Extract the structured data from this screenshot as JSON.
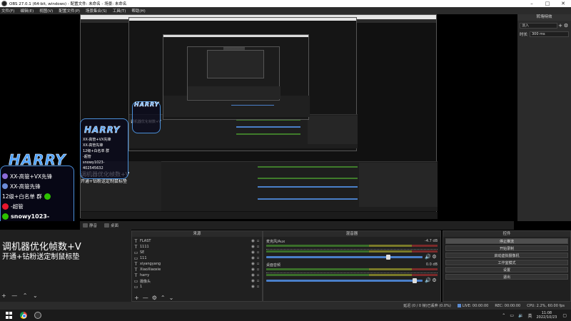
{
  "window": {
    "title": "OBS 27.0.1 (64-bit, windows) - 配置文件: 未命名 - 场景: 未命名",
    "controls": [
      "–",
      "□",
      "✕"
    ]
  },
  "menu": [
    "文件(F)",
    "编辑(E)",
    "视图(V)",
    "配置文件(P)",
    "场景集合(S)",
    "工具(T)",
    "帮助(H)"
  ],
  "right_panel": {
    "title": "转场特效",
    "transition": "淡入",
    "duration_label": "时长",
    "duration_value": "300 ms"
  },
  "preview_overlay": {
    "logo": "HARRY",
    "lines": [
      "XX-高管+VX先锋",
      "XX-高管先锋",
      "12级+白名单 群",
      "-超管",
      "snowy1023-",
      "402545632"
    ],
    "brand": "骑眉"
  },
  "sub_bar": {
    "mic": "静音",
    "desktop": "桌面"
  },
  "left_bottom": {
    "big_text": "调机器优化帧数+V",
    "small_text": "开通+钻粉送定制鼠标垫",
    "footer": [
      "+",
      "—",
      "⌃",
      "⌄"
    ]
  },
  "sources": {
    "title": "来源",
    "items": [
      {
        "icon": "T",
        "name": "FLAST"
      },
      {
        "icon": "T",
        "name": "1111"
      },
      {
        "icon": "▭",
        "name": "SE"
      },
      {
        "icon": "▭",
        "name": "111"
      },
      {
        "icon": "T",
        "name": "xiyangyang"
      },
      {
        "icon": "T",
        "name": "XiaoXiaoxie"
      },
      {
        "icon": "T",
        "name": "harry"
      },
      {
        "icon": "▭",
        "name": "摄像头"
      },
      {
        "icon": "▭",
        "name": "1"
      }
    ],
    "footer": [
      "+",
      "—",
      "⚙",
      "⌃",
      "⌄"
    ]
  },
  "mixer": {
    "title": "混音器",
    "tracks": [
      {
        "name": "麦克风/Aux",
        "db": "-4.7 dB",
        "level": 0.78
      },
      {
        "name": "桌面音频",
        "db": "0.0 dB",
        "level": 0.95
      }
    ]
  },
  "controls": {
    "title": "控件",
    "buttons": [
      "停止推流",
      "开始录制",
      "启动虚拟摄像机",
      "工作室模式",
      "设置",
      "退出"
    ]
  },
  "status": {
    "live": "LIVE: 00:00:00",
    "rec": "REC: 00:00:00",
    "cpu": "CPU: 2.2%, 60.00 fps",
    "drop": "延迟 (0 / 0 帧)已丢弃 (0.0%)"
  },
  "taskbar": {
    "time": "11:08",
    "date": "2022/10/23",
    "lang": "英"
  },
  "colors": {
    "accent": "#4a7fc9",
    "meter_green": "#3f7c2b"
  }
}
